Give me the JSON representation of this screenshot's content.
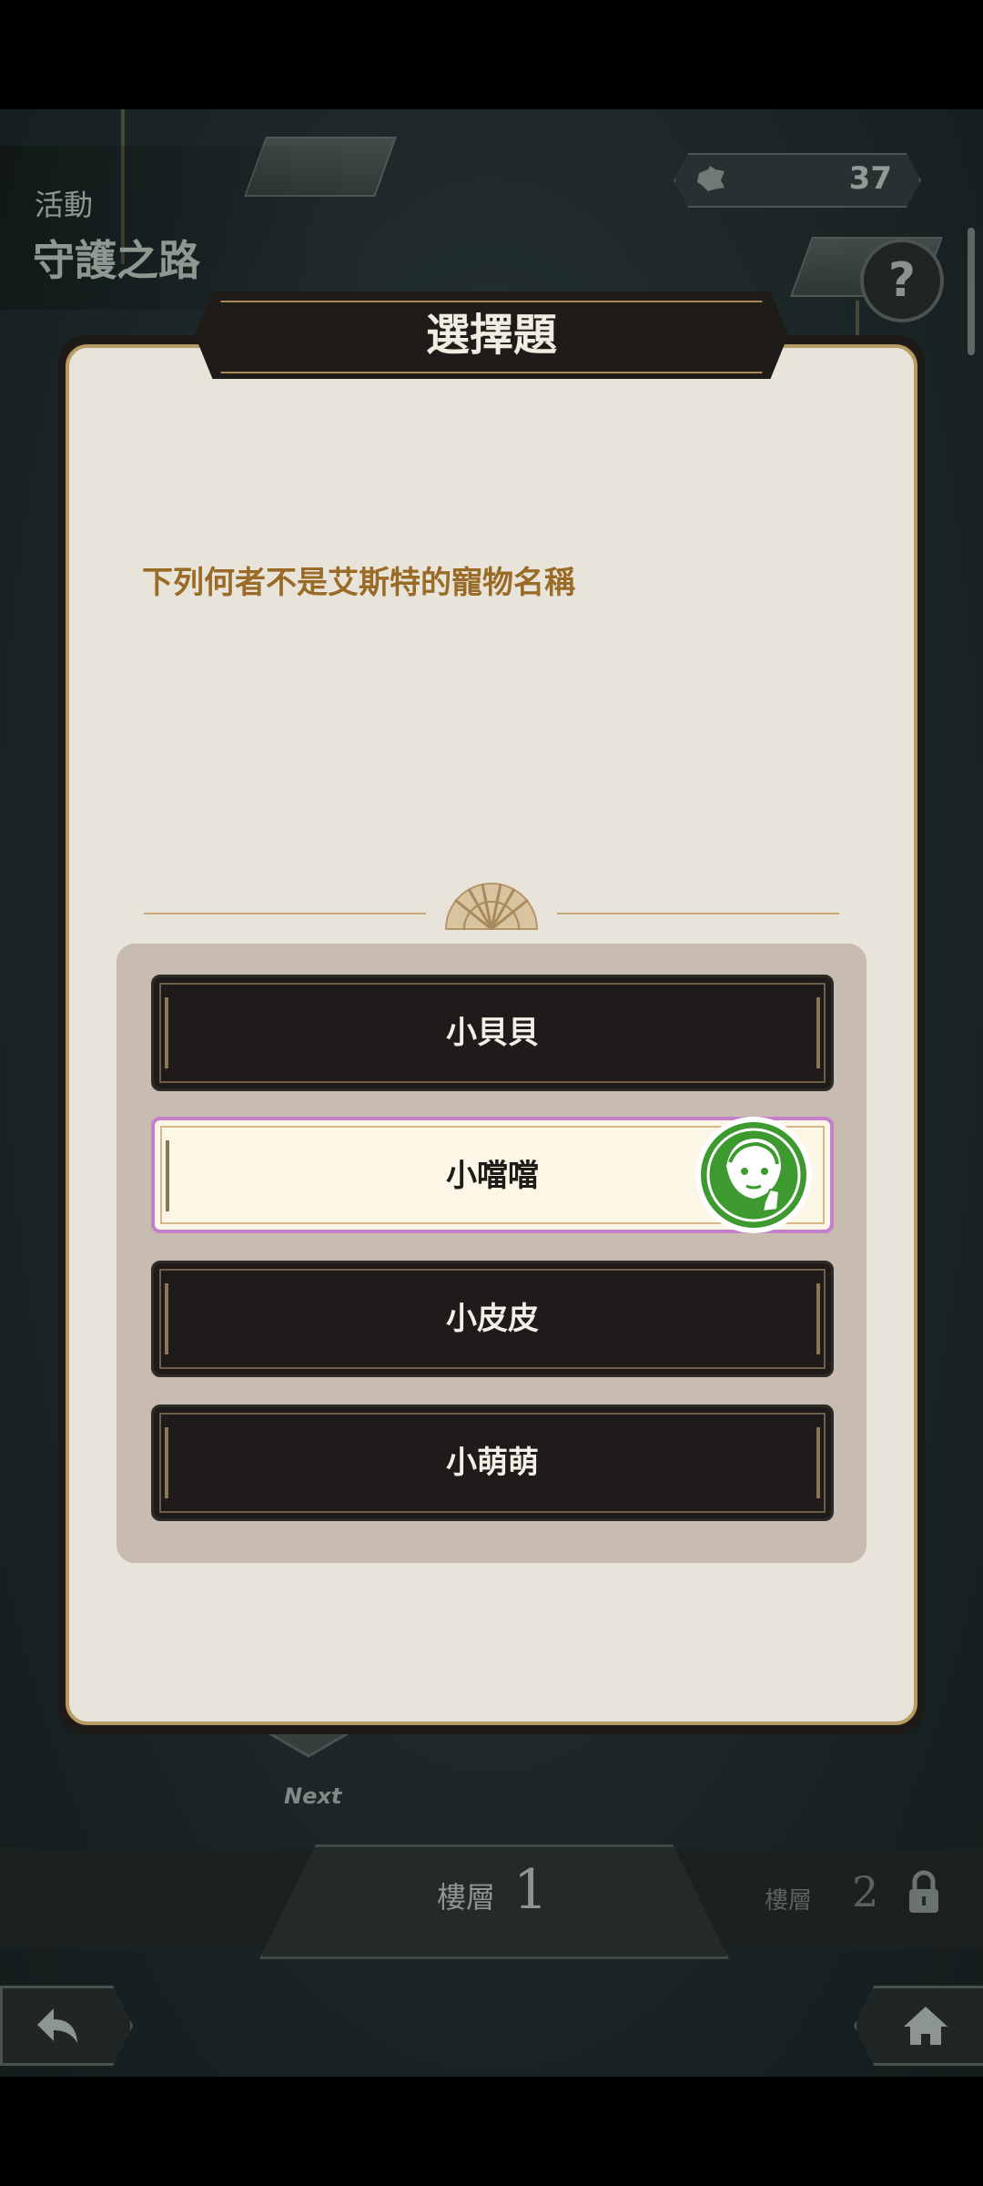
{
  "event": {
    "category": "活動",
    "name": "守護之路"
  },
  "counter": {
    "icon": "puzzle-icon",
    "value": "37"
  },
  "help": {
    "label": "?"
  },
  "modal": {
    "title": "選擇題",
    "question": "下列何者不是艾斯特的寵物名稱",
    "options": [
      {
        "label": "小貝貝",
        "selected": false
      },
      {
        "label": "小噹噹",
        "selected": true
      },
      {
        "label": "小皮皮",
        "selected": false
      },
      {
        "label": "小萌萌",
        "selected": false
      }
    ],
    "selected_badge_icon": "character-thumbs-up-icon"
  },
  "map": {
    "next_label": "Next"
  },
  "floors": {
    "current_label": "樓層",
    "current_number": "1",
    "next_label": "樓層",
    "next_number": "2",
    "next_locked": true
  },
  "nav": {
    "back_icon": "back-arrow-icon",
    "home_icon": "home-icon"
  },
  "colors": {
    "accent_gold": "#b79b64",
    "question_text": "#9a6b27",
    "selected_border": "#c37fc7",
    "badge_green": "#3c9a2f"
  }
}
